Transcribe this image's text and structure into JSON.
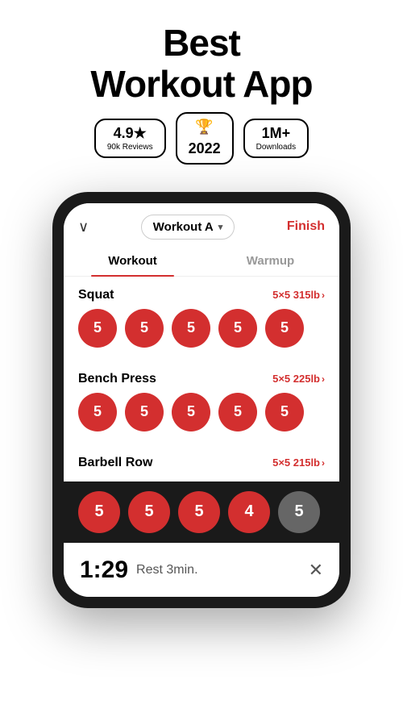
{
  "header": {
    "title_line1": "Best",
    "title_line2": "Workout App"
  },
  "badges": [
    {
      "id": "rating",
      "main": "4.9★",
      "sub": "90k Reviews"
    },
    {
      "id": "award",
      "main": "2022",
      "sub": "",
      "trophy": true
    },
    {
      "id": "downloads",
      "main": "1M+",
      "sub": "Downloads"
    }
  ],
  "app": {
    "chevron": "∨",
    "workout_name": "Workout A",
    "dropdown_arrow": "▾",
    "finish_label": "Finish",
    "tabs": [
      {
        "label": "Workout",
        "active": true
      },
      {
        "label": "Warmup",
        "active": false
      }
    ],
    "exercises": [
      {
        "name": "Squat",
        "sets_info": "5×5 315lb",
        "bubbles": [
          5,
          5,
          5,
          5,
          5
        ]
      },
      {
        "name": "Bench Press",
        "sets_info": "5×5 225lb",
        "bubbles": [
          5,
          5,
          5,
          5,
          5
        ]
      },
      {
        "name": "Barbell Row",
        "sets_info": "5×5 215lb",
        "bubbles": []
      }
    ],
    "bottom_bubbles": [
      5,
      5,
      5,
      4
    ],
    "bottom_last": 5,
    "timer": {
      "time": "1:29",
      "label": "Rest 3min.",
      "close": "✕"
    }
  }
}
